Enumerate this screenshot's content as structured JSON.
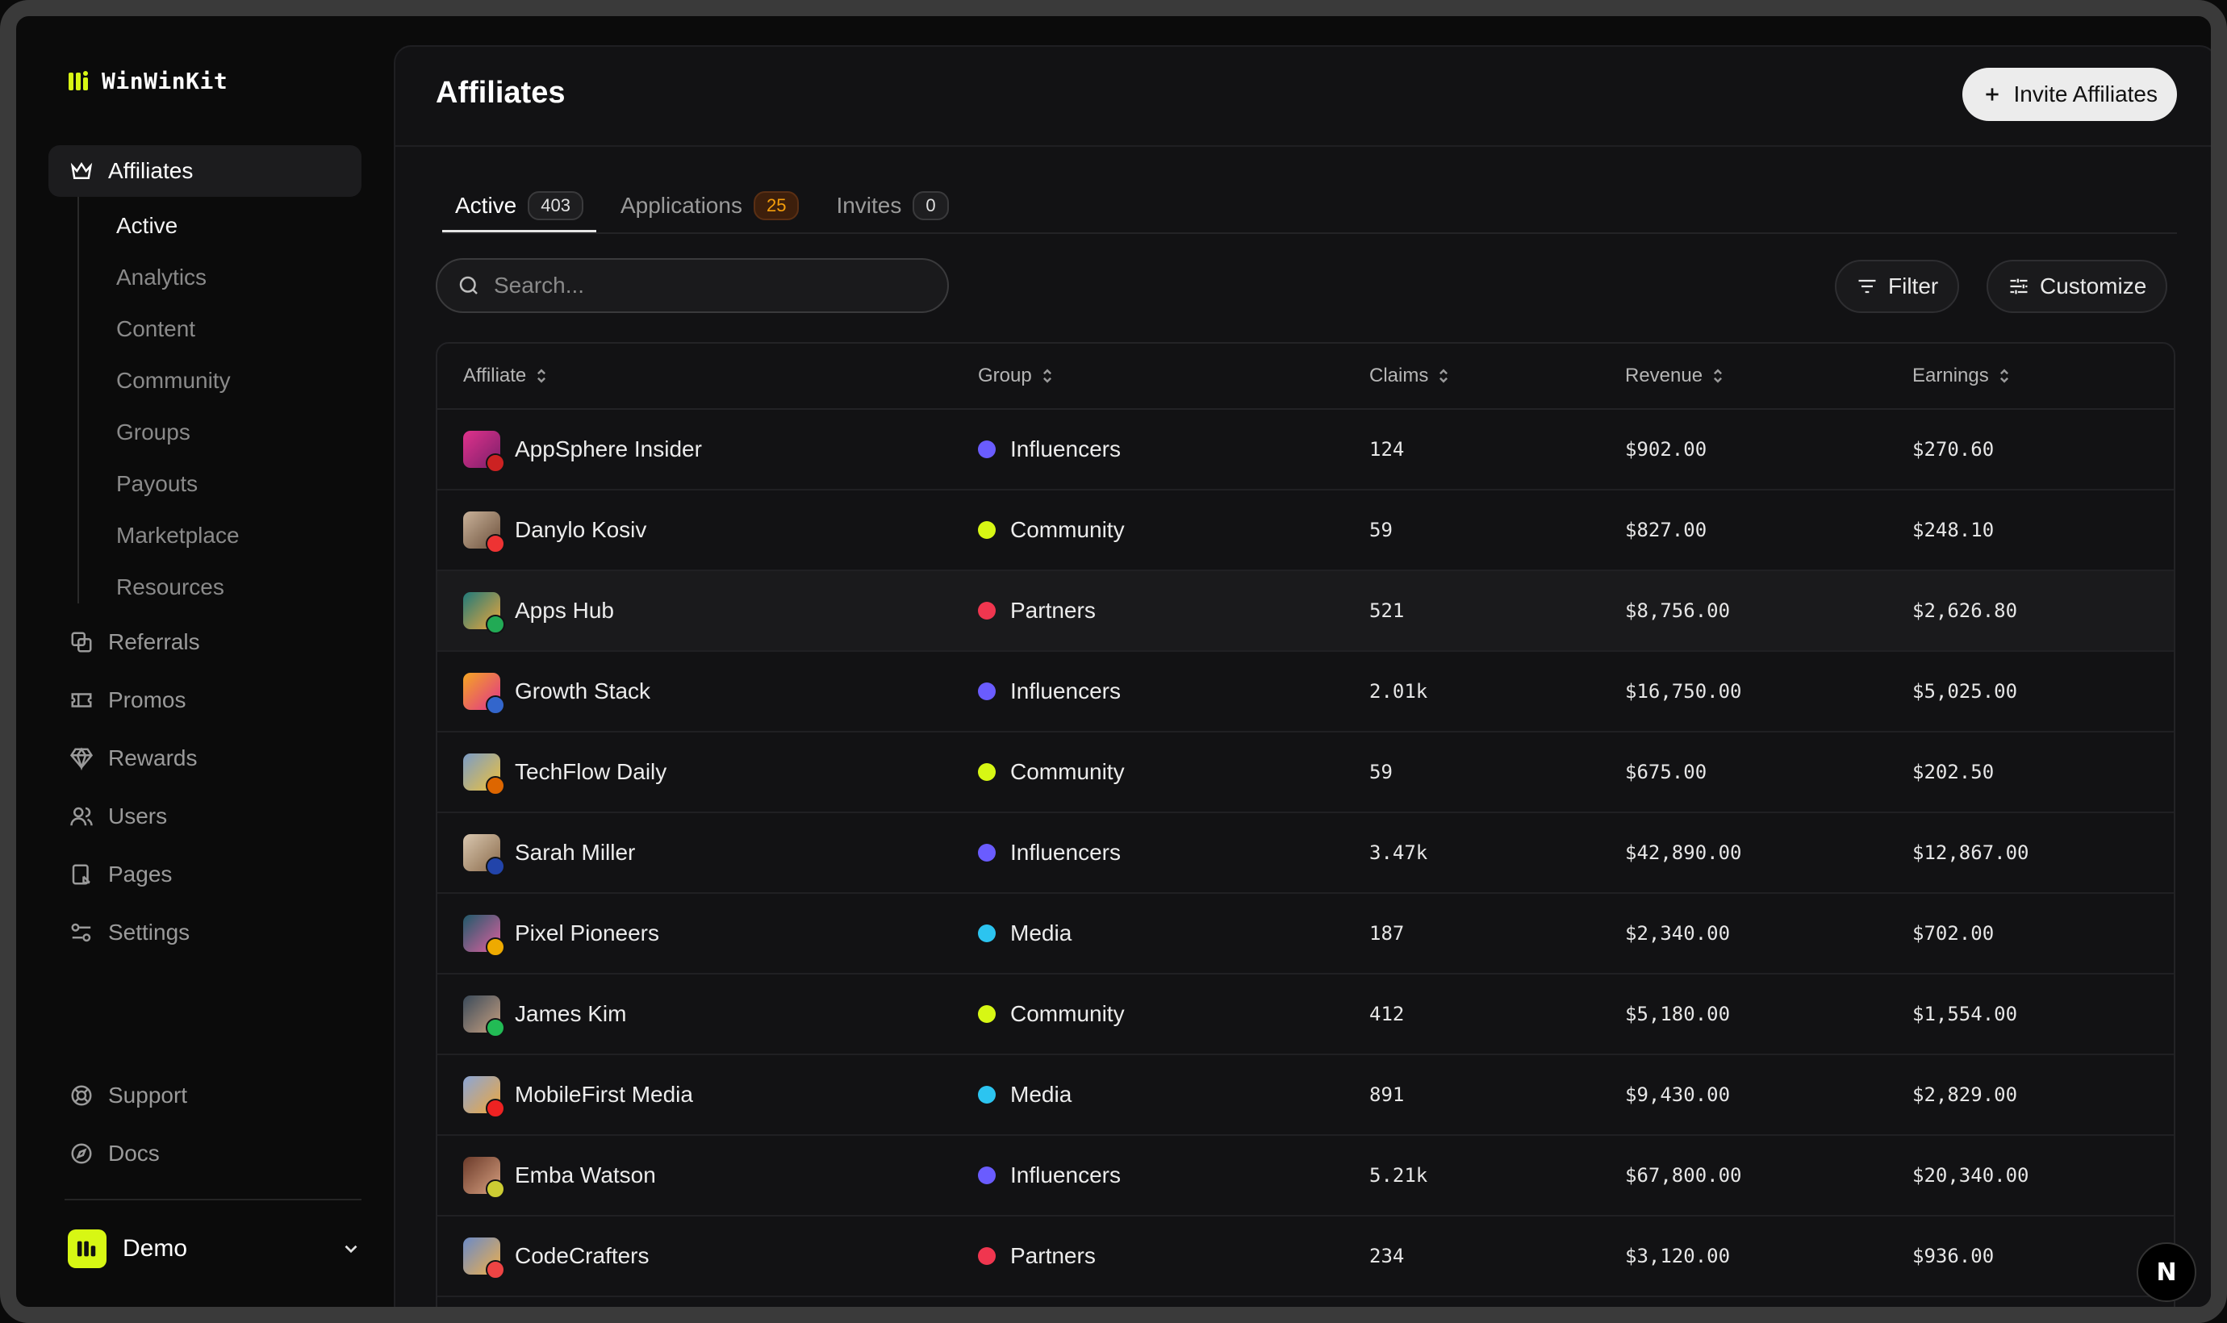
{
  "app": {
    "brand": "WinWinKit"
  },
  "sidebar": {
    "section": {
      "label": "Affiliates"
    },
    "subitems": [
      "Active",
      "Analytics",
      "Content",
      "Community",
      "Groups",
      "Payouts",
      "Marketplace",
      "Resources"
    ],
    "items": [
      {
        "label": "Referrals",
        "icon": "referrals-icon"
      },
      {
        "label": "Promos",
        "icon": "ticket-icon"
      },
      {
        "label": "Rewards",
        "icon": "gem-icon"
      },
      {
        "label": "Users",
        "icon": "users-icon"
      },
      {
        "label": "Pages",
        "icon": "pages-icon"
      },
      {
        "label": "Settings",
        "icon": "settings-icon"
      }
    ],
    "bottom": [
      {
        "label": "Support",
        "icon": "lifebuoy-icon"
      },
      {
        "label": "Docs",
        "icon": "compass-icon"
      }
    ],
    "workspace": {
      "name": "Demo"
    }
  },
  "header": {
    "title": "Affiliates",
    "invite_label": "Invite Affiliates"
  },
  "tabs": [
    {
      "label": "Active",
      "count": "403"
    },
    {
      "label": "Applications",
      "count": "25"
    },
    {
      "label": "Invites",
      "count": "0"
    }
  ],
  "search": {
    "placeholder": "Search..."
  },
  "toolbar": {
    "filter_label": "Filter",
    "customize_label": "Customize"
  },
  "table": {
    "columns": [
      "Affiliate",
      "Group",
      "Claims",
      "Revenue",
      "Earnings"
    ],
    "rows": [
      {
        "name": "AppSphere Insider",
        "group": "Influencers",
        "claims": "124",
        "revenue": "$902.00",
        "earnings": "$270.60"
      },
      {
        "name": "Danylo Kosiv",
        "group": "Community",
        "claims": "59",
        "revenue": "$827.00",
        "earnings": "$248.10"
      },
      {
        "name": "Apps Hub",
        "group": "Partners",
        "claims": "521",
        "revenue": "$8,756.00",
        "earnings": "$2,626.80"
      },
      {
        "name": "Growth Stack",
        "group": "Influencers",
        "claims": "2.01k",
        "revenue": "$16,750.00",
        "earnings": "$5,025.00"
      },
      {
        "name": "TechFlow Daily",
        "group": "Community",
        "claims": "59",
        "revenue": "$675.00",
        "earnings": "$202.50"
      },
      {
        "name": "Sarah Miller",
        "group": "Influencers",
        "claims": "3.47k",
        "revenue": "$42,890.00",
        "earnings": "$12,867.00"
      },
      {
        "name": "Pixel Pioneers",
        "group": "Media",
        "claims": "187",
        "revenue": "$2,340.00",
        "earnings": "$702.00"
      },
      {
        "name": "James Kim",
        "group": "Community",
        "claims": "412",
        "revenue": "$5,180.00",
        "earnings": "$1,554.00"
      },
      {
        "name": "MobileFirst Media",
        "group": "Media",
        "claims": "891",
        "revenue": "$9,430.00",
        "earnings": "$2,829.00"
      },
      {
        "name": "Emba Watson",
        "group": "Influencers",
        "claims": "5.21k",
        "revenue": "$67,800.00",
        "earnings": "$20,340.00"
      },
      {
        "name": "CodeCrafters",
        "group": "Partners",
        "claims": "234",
        "revenue": "$3,120.00",
        "earnings": "$936.00"
      }
    ]
  },
  "group_colors": {
    "Influencers": "#6a5cff",
    "Community": "#d7f714",
    "Partners": "#f0364f",
    "Media": "#2cc4f0"
  },
  "dev_badge": {
    "label": "N"
  }
}
